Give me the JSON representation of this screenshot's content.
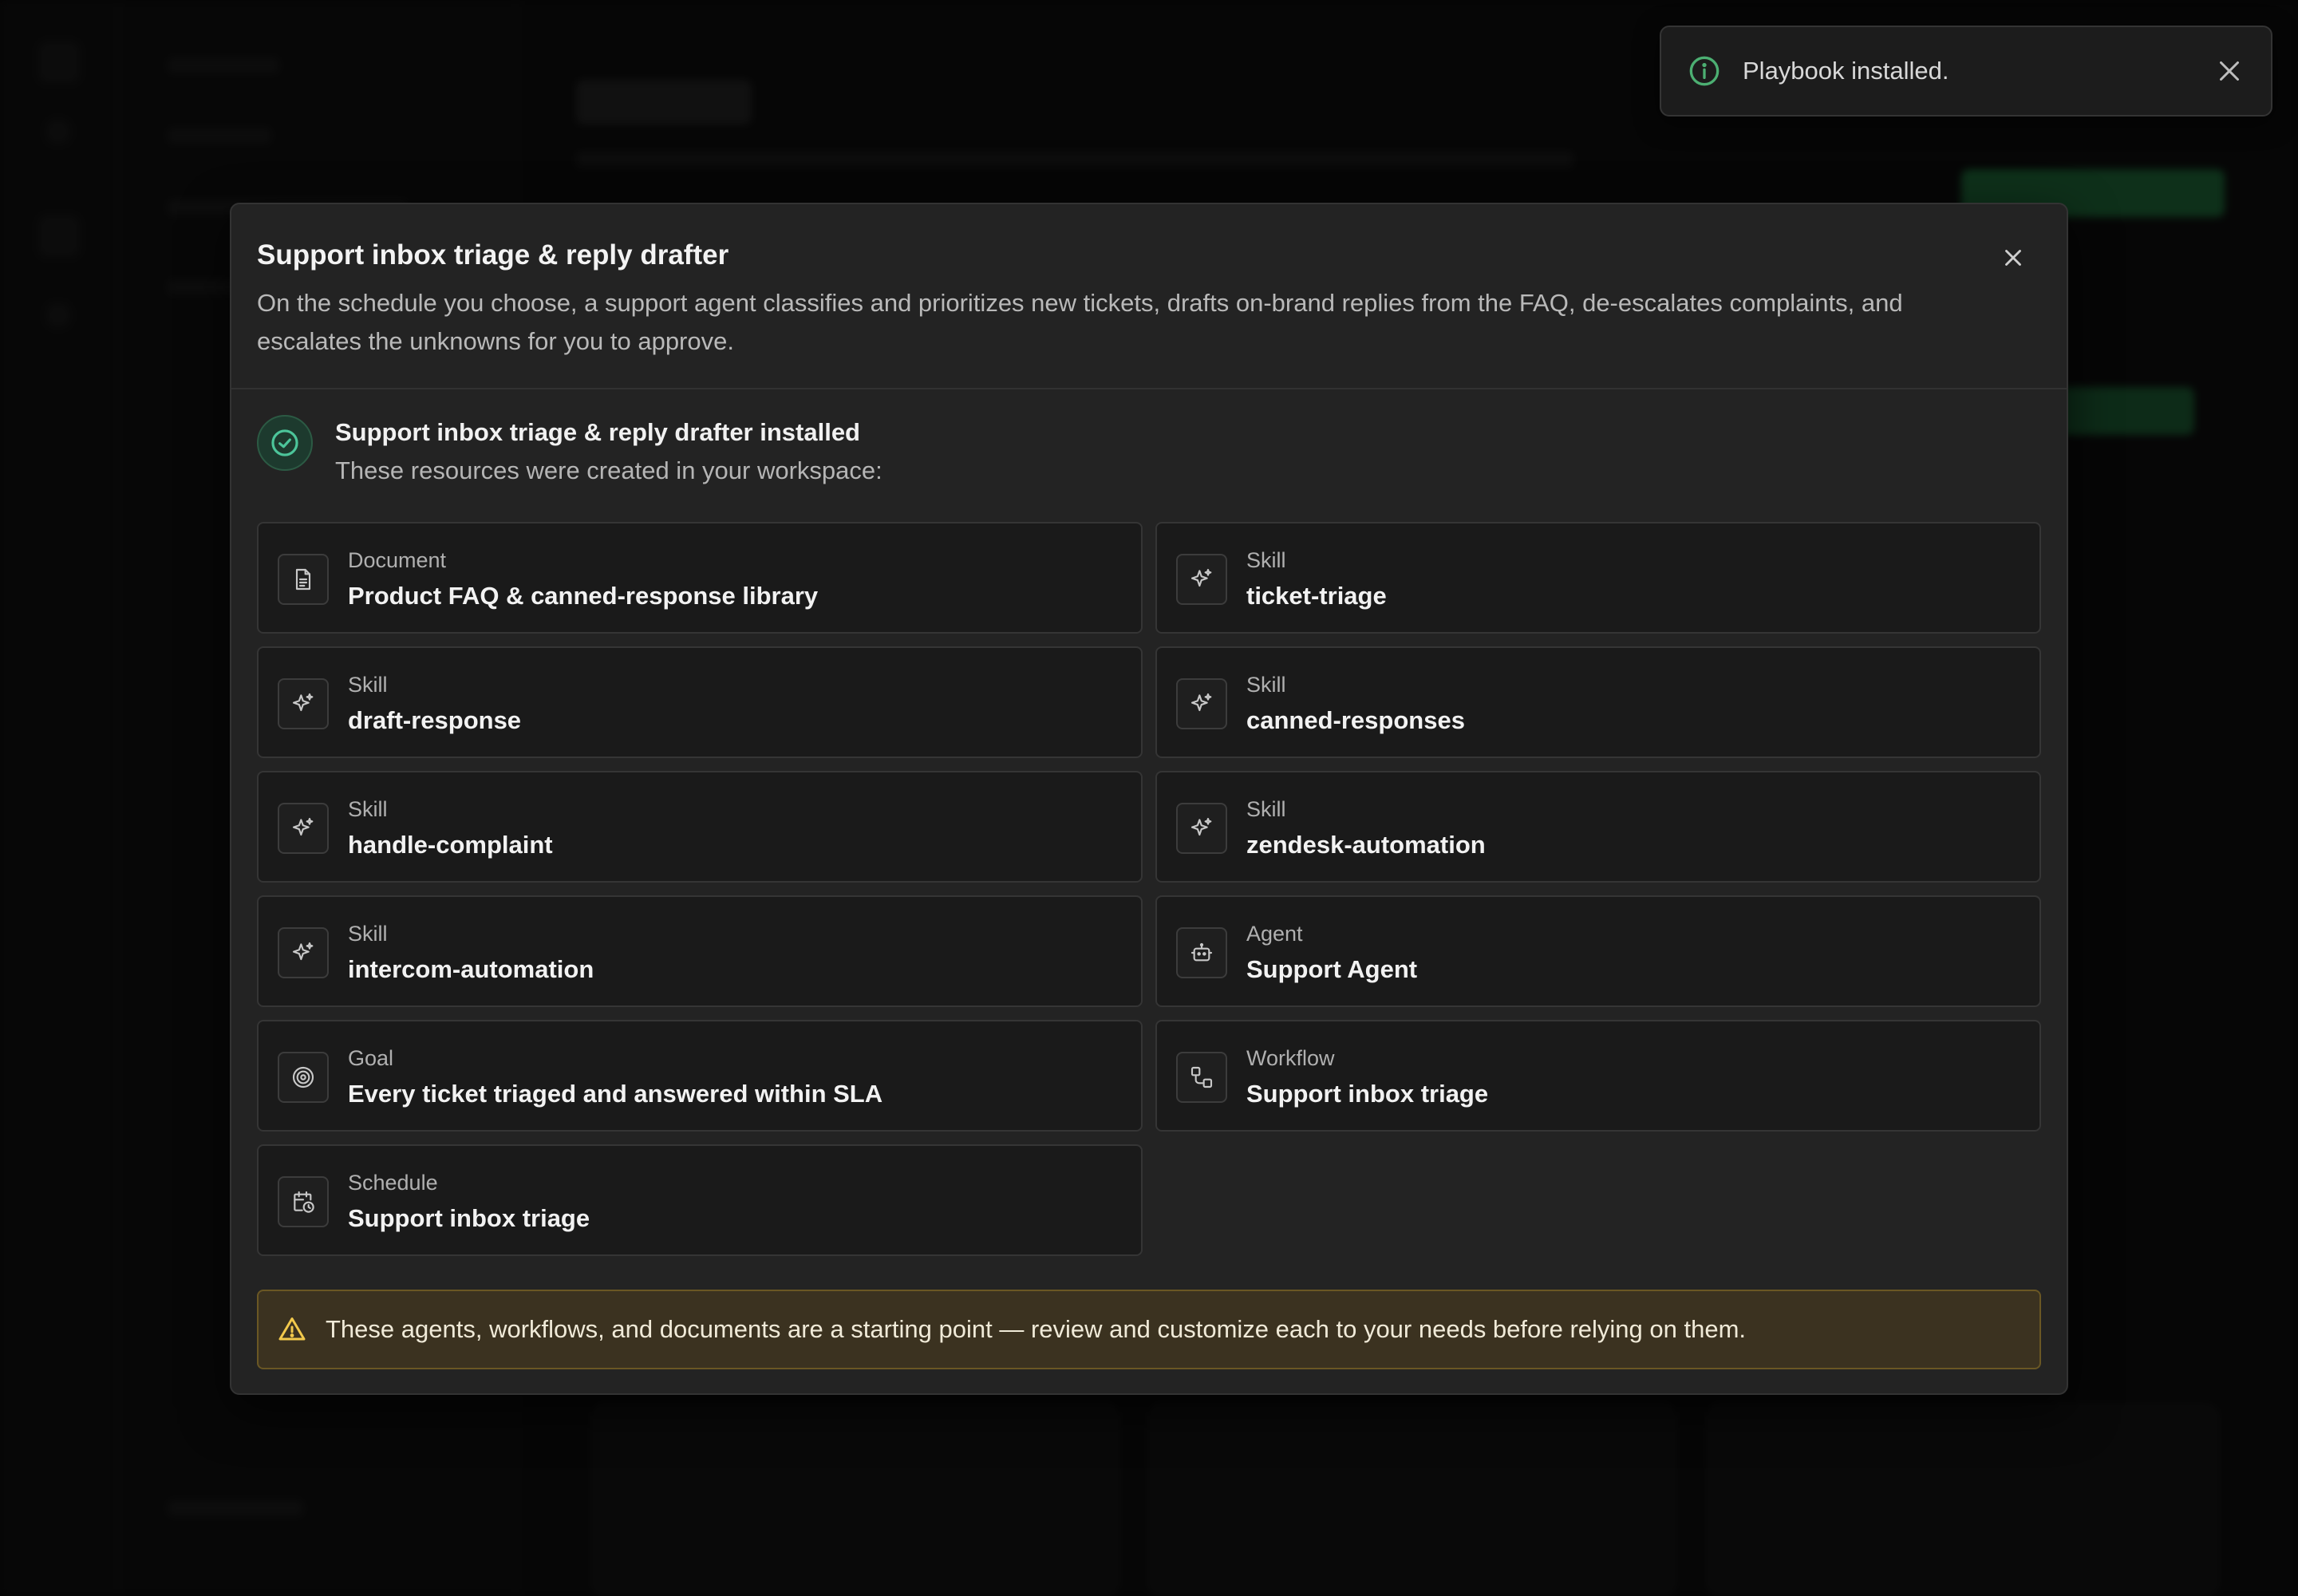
{
  "toast": {
    "message": "Playbook installed.",
    "icon": "info-icon",
    "accent": "#4caf72"
  },
  "modal": {
    "title": "Support inbox triage & reply drafter",
    "description": "On the schedule you choose, a support agent classifies and prioritizes new tickets, drafts on-brand replies from the FAQ, de-escalates complaints, and escalates the unknowns for you to approve.",
    "installed_title": "Support inbox triage & reply drafter installed",
    "installed_subtitle": "These resources were created in your workspace:",
    "resources": [
      {
        "type": "Document",
        "name": "Product FAQ & canned-response library",
        "icon": "document-icon"
      },
      {
        "type": "Skill",
        "name": "ticket-triage",
        "icon": "sparkle-icon"
      },
      {
        "type": "Skill",
        "name": "draft-response",
        "icon": "sparkle-icon"
      },
      {
        "type": "Skill",
        "name": "canned-responses",
        "icon": "sparkle-icon"
      },
      {
        "type": "Skill",
        "name": "handle-complaint",
        "icon": "sparkle-icon"
      },
      {
        "type": "Skill",
        "name": "zendesk-automation",
        "icon": "sparkle-icon"
      },
      {
        "type": "Skill",
        "name": "intercom-automation",
        "icon": "sparkle-icon"
      },
      {
        "type": "Agent",
        "name": "Support Agent",
        "icon": "bot-icon"
      },
      {
        "type": "Goal",
        "name": "Every ticket triaged and answered within SLA",
        "icon": "target-icon"
      },
      {
        "type": "Workflow",
        "name": "Support inbox triage",
        "icon": "workflow-icon"
      },
      {
        "type": "Schedule",
        "name": "Support inbox triage",
        "icon": "calendar-clock-icon"
      }
    ],
    "warning": "These agents, workflows, and documents are a starting point — review and customize each to your needs before relying on them.",
    "colors": {
      "success": "#4cc59a",
      "warning": "#f2c94c",
      "warning_bg": "#3b3220"
    }
  }
}
